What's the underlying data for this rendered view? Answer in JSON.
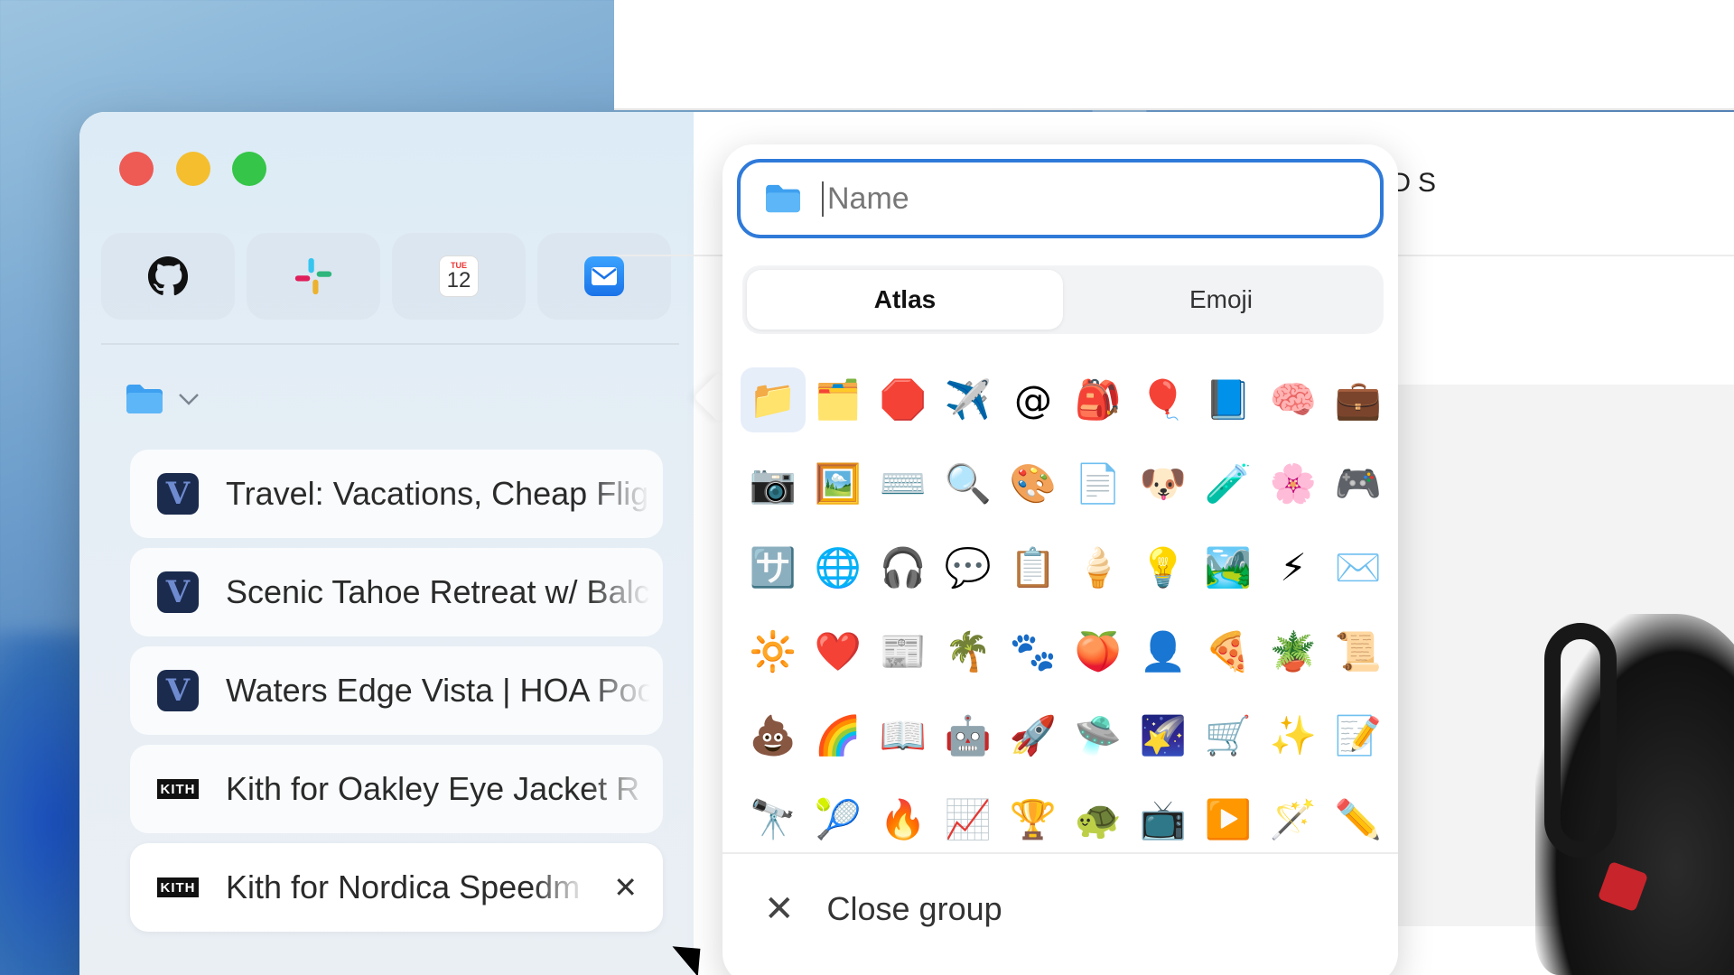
{
  "pinned_apps": [
    {
      "name": "github-icon",
      "glyph": "🐱"
    },
    {
      "name": "slack-icon",
      "glyph": "✳"
    },
    {
      "name": "calendar-icon",
      "day_label": "TUE",
      "day": "12"
    },
    {
      "name": "mail-icon",
      "glyph": "✉"
    }
  ],
  "group": {
    "icon": "folder-icon"
  },
  "tabs": [
    {
      "title": "Travel: Vacations, Cheap Flig",
      "favicon": "V"
    },
    {
      "title": "Scenic Tahoe Retreat w/ Balc",
      "favicon": "V"
    },
    {
      "title": "Waters Edge Vista | HOA Poo",
      "favicon": "V"
    },
    {
      "title": "Kith for Oakley Eye Jacket R",
      "favicon": "KITH"
    },
    {
      "title": "Kith for Nordica Speedm",
      "favicon": "KITH",
      "close": "✕"
    }
  ],
  "content": {
    "heading": "KIDS"
  },
  "popup": {
    "name_placeholder": "Name",
    "tabs": [
      "Atlas",
      "Emoji"
    ],
    "icons": [
      "📁",
      "🗂️",
      "🛑",
      "✈️",
      "@",
      "🎒",
      "🎈",
      "📘",
      "🧠",
      "💼",
      "📷",
      "🖼️",
      "⌨️",
      "🔍",
      "🎨",
      "📄",
      "🐶",
      "🧪",
      "🌸",
      "🎮",
      "🈂️",
      "🌐",
      "🎧",
      "💬",
      "📋",
      "🍦",
      "💡",
      "🏞️",
      "⚡",
      "✉️",
      "🔆",
      "❤️",
      "📰",
      "🌴",
      "🐾",
      "🍑",
      "👤",
      "🍕",
      "🪴",
      "📜",
      "💩",
      "🌈",
      "📖",
      "🤖",
      "🚀",
      "🛸",
      "🌠",
      "🛒",
      "✨",
      "📝",
      "🔭",
      "🎾",
      "🔥",
      "📈",
      "🏆",
      "🐢",
      "📺",
      "▶️",
      "🪄",
      "✏️"
    ],
    "close_label": "Close group",
    "close_icon": "✕"
  }
}
